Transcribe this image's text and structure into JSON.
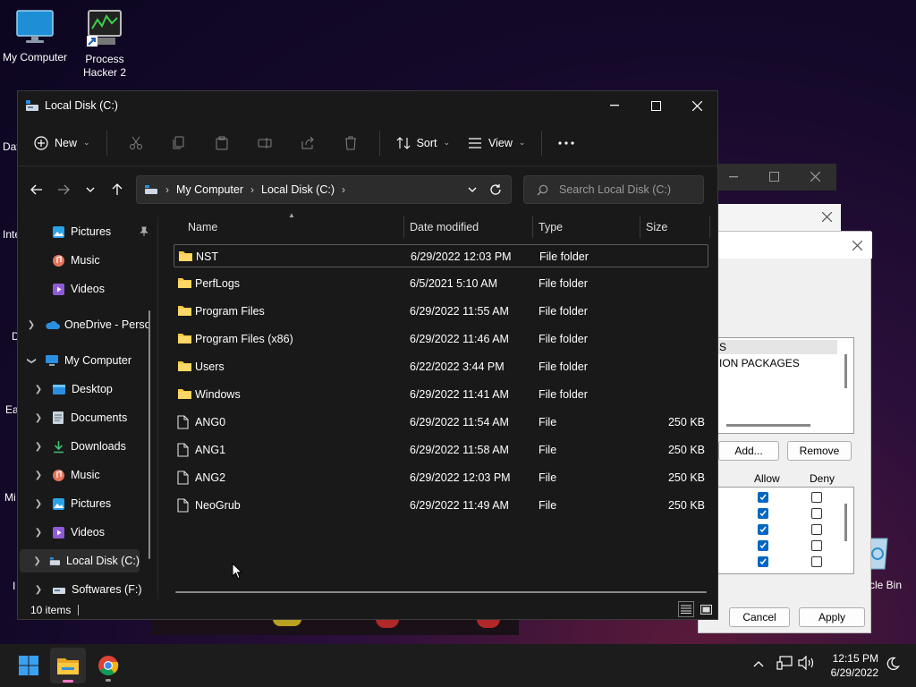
{
  "desktop": {
    "icons": [
      {
        "label": "My Computer"
      },
      {
        "label": "Process Hacker 2"
      }
    ],
    "clipped_labels": [
      "Dat",
      "Inte",
      "D",
      "Ea",
      "Mi",
      "I",
      "cle Bin"
    ]
  },
  "bg_dialogs": {
    "list_lines": [
      "S",
      "ION PACKAGES"
    ],
    "add_label": "Add...",
    "remove_label": "Remove",
    "allow_label": "Allow",
    "deny_label": "Deny",
    "cancel_label": "Cancel",
    "apply_label": "Apply"
  },
  "explorer": {
    "title": "Local Disk (C:)",
    "toolbar": {
      "new_label": "New",
      "sort_label": "Sort",
      "view_label": "View"
    },
    "address": {
      "crumbs": [
        "My Computer",
        "Local Disk (C:)"
      ]
    },
    "search": {
      "placeholder": "Search Local Disk (C:)"
    },
    "sidebar": [
      {
        "label": "Pictures",
        "icon": "pictures-icon",
        "pinned": true
      },
      {
        "label": "Music",
        "icon": "music-icon"
      },
      {
        "label": "Videos",
        "icon": "videos-icon"
      },
      {
        "label": "OneDrive - Perso",
        "icon": "onedrive-icon"
      },
      {
        "label": "My Computer",
        "icon": "computer-icon"
      },
      {
        "label": "Desktop",
        "icon": "desktop-icon"
      },
      {
        "label": "Documents",
        "icon": "documents-icon"
      },
      {
        "label": "Downloads",
        "icon": "downloads-icon"
      },
      {
        "label": "Music",
        "icon": "music-icon"
      },
      {
        "label": "Pictures",
        "icon": "pictures-icon"
      },
      {
        "label": "Videos",
        "icon": "videos-icon"
      },
      {
        "label": "Local Disk (C:)",
        "icon": "drive-icon",
        "selected": true
      },
      {
        "label": "Softwares (F:)",
        "icon": "drive-icon"
      }
    ],
    "columns": {
      "name": "Name",
      "date": "Date modified",
      "type": "Type",
      "size": "Size"
    },
    "files": [
      {
        "name": "NST",
        "date": "6/29/2022 12:03 PM",
        "type": "File folder",
        "size": "",
        "kind": "folder"
      },
      {
        "name": "PerfLogs",
        "date": "6/5/2021 5:10 AM",
        "type": "File folder",
        "size": "",
        "kind": "folder"
      },
      {
        "name": "Program Files",
        "date": "6/29/2022 11:55 AM",
        "type": "File folder",
        "size": "",
        "kind": "folder"
      },
      {
        "name": "Program Files (x86)",
        "date": "6/29/2022 11:46 AM",
        "type": "File folder",
        "size": "",
        "kind": "folder"
      },
      {
        "name": "Users",
        "date": "6/22/2022 3:44 PM",
        "type": "File folder",
        "size": "",
        "kind": "folder"
      },
      {
        "name": "Windows",
        "date": "6/29/2022 11:41 AM",
        "type": "File folder",
        "size": "",
        "kind": "folder"
      },
      {
        "name": "ANG0",
        "date": "6/29/2022 11:54 AM",
        "type": "File",
        "size": "250 KB",
        "kind": "file"
      },
      {
        "name": "ANG1",
        "date": "6/29/2022 11:58 AM",
        "type": "File",
        "size": "250 KB",
        "kind": "file"
      },
      {
        "name": "ANG2",
        "date": "6/29/2022 12:03 PM",
        "type": "File",
        "size": "250 KB",
        "kind": "file"
      },
      {
        "name": "NeoGrub",
        "date": "6/29/2022 11:49 AM",
        "type": "File",
        "size": "250 KB",
        "kind": "file"
      }
    ],
    "status": {
      "items": "10 items"
    }
  },
  "taskbar": {
    "time": "12:15 PM",
    "date": "6/29/2022"
  },
  "colors": {
    "folder": "#f7c948",
    "accent": "#0067c0",
    "window_bg": "#191919"
  }
}
